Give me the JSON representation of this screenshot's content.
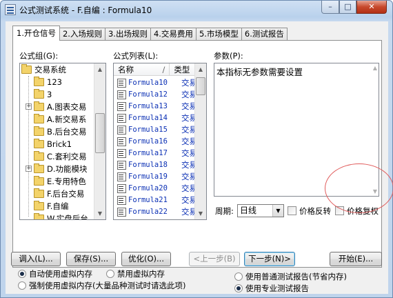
{
  "window": {
    "title": "公式测试系统 - F.自编 : Formula10",
    "min_glyph": "–",
    "max_glyph": "□",
    "close_glyph": "✕"
  },
  "tabs": [
    {
      "label": "1.开仓信号",
      "active": true
    },
    {
      "label": "2.入场规则",
      "active": false
    },
    {
      "label": "3.出场规则",
      "active": false
    },
    {
      "label": "4.交易费用",
      "active": false
    },
    {
      "label": "5.市场模型",
      "active": false
    },
    {
      "label": "6.测试报告",
      "active": false
    }
  ],
  "formula_group": {
    "label": "公式组(G):",
    "items": [
      "交易系统",
      "123",
      "3",
      "A.图表交易",
      "A.新交易系",
      "B.后台交易",
      "Brick1",
      "C.套利交易",
      "D.功能模块",
      "E.专用特色",
      "F.后台交易",
      "F.自编",
      "W.实盘后台"
    ]
  },
  "formula_list": {
    "label": "公式列表(L):",
    "col_name": "名称",
    "col_sort": "/",
    "col_type": "类型",
    "rows": [
      {
        "name": "Formula10",
        "type": "交易"
      },
      {
        "name": "Formula12",
        "type": "交易"
      },
      {
        "name": "Formula13",
        "type": "交易"
      },
      {
        "name": "Formula14",
        "type": "交易"
      },
      {
        "name": "Formula15",
        "type": "交易"
      },
      {
        "name": "Formula16",
        "type": "交易"
      },
      {
        "name": "Formula17",
        "type": "交易"
      },
      {
        "name": "Formula18",
        "type": "交易"
      },
      {
        "name": "Formula19",
        "type": "交易"
      },
      {
        "name": "Formula20",
        "type": "交易"
      },
      {
        "name": "Formula21",
        "type": "交易"
      },
      {
        "name": "Formula22",
        "type": "交易"
      }
    ]
  },
  "params": {
    "label": "参数(P):",
    "text": "本指标无参数需要设置"
  },
  "period": {
    "label": "周期:",
    "value": "日线"
  },
  "options": {
    "price_reverse": "价格反转",
    "price_restore": "价格复权"
  },
  "buttons": {
    "load": "调入(L)...",
    "save": "保存(S)...",
    "optimize": "优化(O)...",
    "prev": "<上一步(B)",
    "next": "下一步(N)>",
    "start": "开始(E)..."
  },
  "memory_options": {
    "auto_virtual": "自动使用虚拟内存",
    "disable_virtual": "禁用虚拟内存",
    "force_virtual": "强制使用虚拟内存(大量品种测试时请选此项)"
  },
  "report_options": {
    "normal": "使用普通测试报告(节省内存)",
    "pro": "使用专业测试报告"
  }
}
